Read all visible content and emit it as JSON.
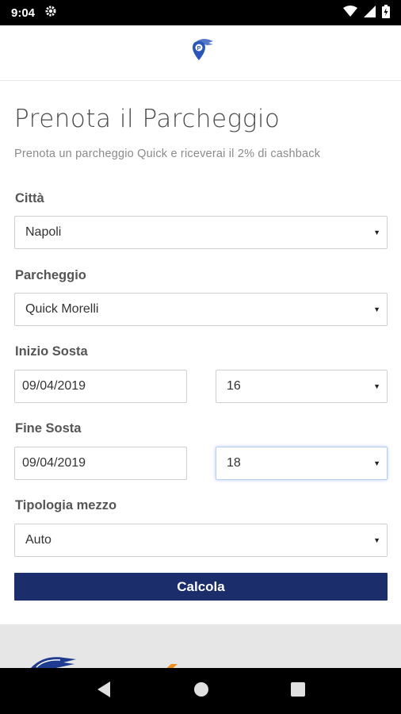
{
  "status": {
    "time": "9:04",
    "icons": [
      "settings-gear-icon",
      "wifi-icon",
      "signal-icon",
      "battery-icon"
    ]
  },
  "header": {
    "logo": "quick-parking-logo-icon"
  },
  "page": {
    "title": "Prenota il Parcheggio",
    "subtitle": "Prenota un parcheggio Quick e riceverai il 2% di cashback"
  },
  "form": {
    "city": {
      "label": "Città",
      "value": "Napoli"
    },
    "parking": {
      "label": "Parcheggio",
      "value": "Quick Morelli"
    },
    "start": {
      "label": "Inizio Sosta",
      "date": "09/04/2019",
      "hour": "16"
    },
    "end": {
      "label": "Fine Sosta",
      "date": "09/04/2019",
      "hour": "18"
    },
    "vehicle": {
      "label": "Tipologia mezzo",
      "value": "Auto"
    },
    "submit_label": "Calcola"
  },
  "colors": {
    "primary": "#1b2d6b",
    "accent_orange": "#f08c1e",
    "logo_blue": "#2a56b8"
  },
  "navbar": {
    "buttons": [
      "back-icon",
      "home-icon",
      "recents-icon"
    ]
  }
}
